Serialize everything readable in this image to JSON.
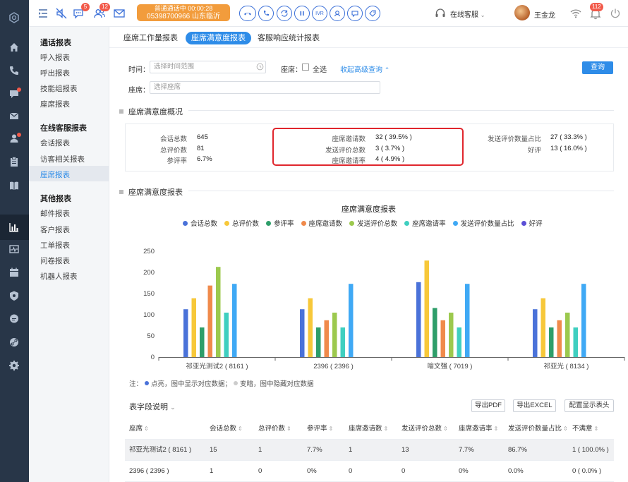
{
  "topbar": {
    "badges": {
      "chat": "5",
      "users": "12",
      "notifications": "112"
    },
    "call_status": "普通通话中  00:00:28",
    "call_info": "05398700966 山东临沂",
    "ivr": "IVR",
    "online_label": "在线客服",
    "username": "王金龙"
  },
  "subnav": {
    "groups": [
      {
        "title": "通话报表",
        "items": [
          "呼入报表",
          "呼出报表",
          "技能组报表",
          "座席报表"
        ]
      },
      {
        "title": "在线客服报表",
        "items": [
          "会话报表",
          "访客相关报表",
          "座席报表"
        ]
      },
      {
        "title": "其他报表",
        "items": [
          "邮件报表",
          "客户报表",
          "工单报表",
          "问卷报表",
          "机器人报表"
        ]
      }
    ]
  },
  "tabs": [
    "座席工作量报表",
    "座席满意度报表",
    "客服响应统计报表"
  ],
  "filters": {
    "time_label": "时间：",
    "time_placeholder": "选择时间范围",
    "seat_all_label": "座席：",
    "select_all": "全选",
    "collapse_link": "收起高级查询",
    "seat_label": "座席：",
    "seat_placeholder": "选择座席",
    "query_button": "查询"
  },
  "overview": {
    "title": "座席满意度概况",
    "col1": [
      {
        "k": "会话总数",
        "v": "645"
      },
      {
        "k": "总评价数",
        "v": "81"
      },
      {
        "k": "参评率",
        "v": "6.7%"
      }
    ],
    "col2": [
      {
        "k": "座席邀请数",
        "v": "32 ( 39.5% )"
      },
      {
        "k": "发送评价总数",
        "v": "3 ( 3.7% )"
      },
      {
        "k": "座席邀请率",
        "v": "4 ( 4.9% )"
      }
    ],
    "col3": [
      {
        "k": "发送评价数量占比",
        "v": "27 ( 33.3% )"
      },
      {
        "k": "好评",
        "v": "13 ( 16.0% )"
      }
    ]
  },
  "report_section_title": "座席满意度报表",
  "chart_data": {
    "type": "bar",
    "title": "座席满意度报表",
    "categories": [
      "祁亚光测试2 ( 8161 )",
      "2396 ( 2396 )",
      "喻文强 ( 7019 )",
      "祁亚光 ( 8134 )"
    ],
    "ylim": [
      0,
      250
    ],
    "yticks": [
      0,
      50,
      100,
      150,
      200,
      250
    ],
    "grid": false,
    "legend_position": "top",
    "series": [
      {
        "name": "会话总数",
        "color": "#4a72d9",
        "values": [
          113,
          113,
          177,
          113
        ]
      },
      {
        "name": "总评价数",
        "color": "#f7c83a",
        "values": [
          139,
          139,
          228,
          139
        ]
      },
      {
        "name": "参评率",
        "color": "#2e9e6a",
        "values": [
          70,
          70,
          116,
          70
        ]
      },
      {
        "name": "座席邀请数",
        "color": "#f08a4b",
        "values": [
          169,
          87,
          87,
          87
        ]
      },
      {
        "name": "发送评价总数",
        "color": "#9cc94e",
        "values": [
          213,
          105,
          105,
          105
        ]
      },
      {
        "name": "座席邀请率",
        "color": "#3fcfc0",
        "values": [
          105,
          70,
          70,
          70
        ]
      },
      {
        "name": "发送评价数量占比",
        "color": "#3fa9f5",
        "values": [
          173,
          173,
          173,
          173
        ]
      },
      {
        "name": "好评",
        "color": "#5b4fd6",
        "values": [
          0,
          0,
          0,
          0
        ]
      }
    ]
  },
  "note": {
    "prefix": "注：",
    "lit": "点亮，图中显示对应数据；",
    "dark": "变暗，图中隐藏对应数据"
  },
  "table_section": {
    "fields_label": "表字段说明",
    "export_pdf": "导出PDF",
    "export_excel": "导出EXCEL",
    "config_header": "配置显示表头"
  },
  "table": {
    "headers": [
      "座席",
      "会话总数",
      "总评价数",
      "参评率",
      "座席邀请数",
      "发送评价总数",
      "座席邀请率",
      "发送评价数量占比",
      "不满意"
    ],
    "rows": [
      [
        "祁亚光测试2 ( 8161 )",
        "15",
        "1",
        "7.7%",
        "1",
        "13",
        "7.7%",
        "86.7%",
        "1 ( 100.0% )"
      ],
      [
        "2396 ( 2396 )",
        "1",
        "0",
        "0%",
        "0",
        "0",
        "0%",
        "0.0%",
        "0 ( 0.0% )"
      ]
    ]
  }
}
